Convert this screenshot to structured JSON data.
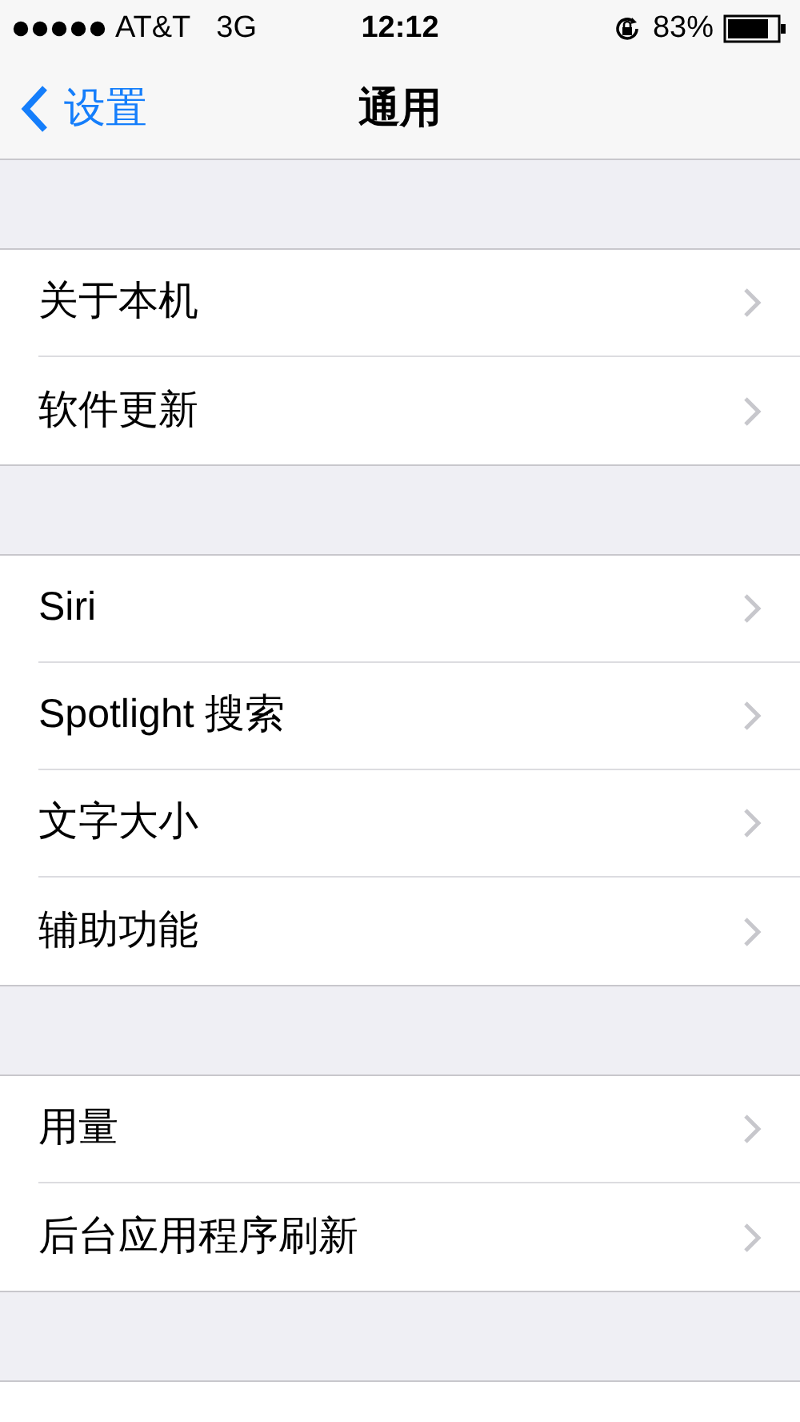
{
  "status_bar": {
    "carrier": "AT&T",
    "network": "3G",
    "time": "12:12",
    "battery": "83%"
  },
  "nav": {
    "back": "设置",
    "title": "通用"
  },
  "groups": [
    {
      "items": [
        {
          "label": "关于本机"
        },
        {
          "label": "软件更新"
        }
      ]
    },
    {
      "items": [
        {
          "label": "Siri"
        },
        {
          "label": "Spotlight 搜索"
        },
        {
          "label": "文字大小"
        },
        {
          "label": "辅助功能"
        }
      ]
    },
    {
      "items": [
        {
          "label": "用量"
        },
        {
          "label": "后台应用程序刷新"
        }
      ]
    }
  ]
}
